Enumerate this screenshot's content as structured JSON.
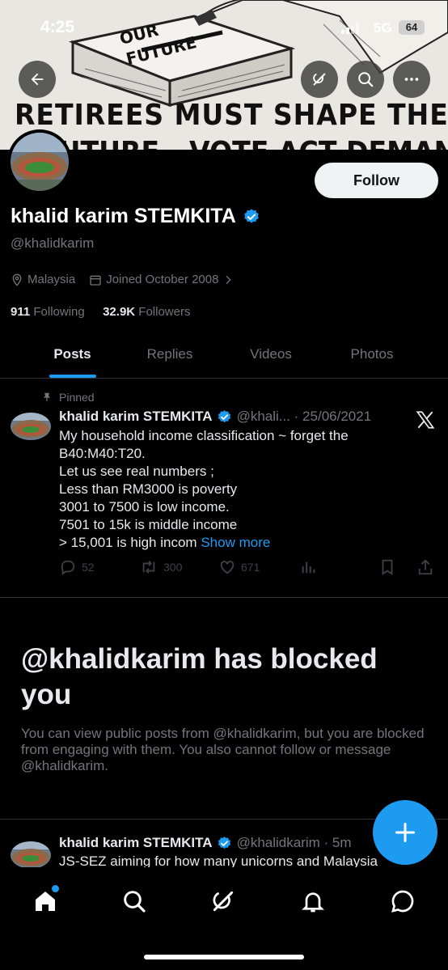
{
  "status_bar": {
    "time": "4:25",
    "network": "5G",
    "battery": "64"
  },
  "banner": {
    "sign_text_1": "OUR",
    "sign_text_2": "FUTURE",
    "caption_line1": "RETIREES MUST SHAPE THEIR",
    "caption_line2": "FUTURE - VOTE ACT DEMAND"
  },
  "top_icons": {
    "back": "arrow-left-icon",
    "grok": "grok-icon",
    "search": "search-icon",
    "more": "more-horizontal-icon"
  },
  "profile": {
    "display_name": "khalid karim STEMKITA",
    "handle": "@khalidkarim",
    "follow_label": "Follow",
    "location": "Malaysia",
    "joined": "Joined October 2008",
    "following_count": "911",
    "following_label": "Following",
    "followers_count": "32.9K",
    "followers_label": "Followers"
  },
  "tabs": [
    {
      "label": "Posts",
      "active": true
    },
    {
      "label": "Replies",
      "active": false
    },
    {
      "label": "Videos",
      "active": false
    },
    {
      "label": "Photos",
      "active": false
    }
  ],
  "pinned_post": {
    "pinned_label": "Pinned",
    "author": "khalid karim STEMKITA",
    "handle_date": "@khali... · 25/06/2021",
    "lines": [
      "My household income classification ~ forget the",
      "B40:M40:T20.",
      "Let us see real numbers ;",
      "Less than RM3000 is poverty",
      "3001 to 7500 is low income.",
      "7501 to 15k is middle income",
      "> 15,001 is high incom"
    ],
    "show_more": "Show more",
    "replies": "52",
    "reposts": "300",
    "likes": "671"
  },
  "blocked": {
    "title": "@khalidkarim has blocked you",
    "message": "You can view public posts from @khalidkarim, but you are blocked from engaging with them. You also cannot follow or message @khalidkarim."
  },
  "second_post": {
    "author": "khalid karim STEMKITA",
    "handle_time": "@khalidkarim · 5m",
    "text": "JS-SEZ aiming for how many unicorns and Malaysia"
  },
  "colors": {
    "accent": "#1d9bf0",
    "background": "#000000",
    "secondary_text": "#71767b"
  },
  "bottom_nav": [
    "home-icon",
    "search-icon",
    "grok-icon",
    "notifications-icon",
    "messages-icon"
  ]
}
